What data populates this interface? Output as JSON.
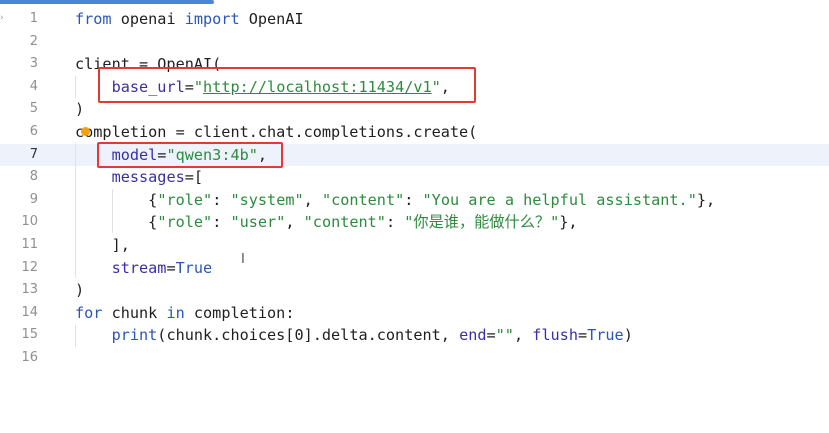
{
  "editor": {
    "accent_color": "#4a86d6",
    "highlight_color": "#e53935",
    "current_line": 7,
    "fold_icon": "fold-arrow-icon",
    "line_numbers": [
      "1",
      "2",
      "3",
      "4",
      "5",
      "6",
      "7",
      "8",
      "9",
      "10",
      "11",
      "12",
      "13",
      "14",
      "15",
      "16"
    ],
    "code": {
      "l1": {
        "kw1": "from",
        "mod": " openai ",
        "kw2": "import",
        "cls": " OpenAI"
      },
      "l3": {
        "text": "client = OpenAI("
      },
      "l4": {
        "param": "base_url",
        "eq": "=",
        "q1": "\"",
        "url": "http://localhost:11434/v1",
        "q2": "\"",
        "comma": ","
      },
      "l5": {
        "text": ")"
      },
      "l6": {
        "text": "completion = client.chat.completions.create("
      },
      "l7": {
        "param": "model",
        "eq": "=",
        "str": "\"qwen3:4b\"",
        "comma": ","
      },
      "l8": {
        "param": "messages",
        "eq": "=",
        "bracket": "["
      },
      "l9": {
        "open": "{",
        "k1": "\"role\"",
        "c1": ": ",
        "v1": "\"system\"",
        "sep": ", ",
        "k2": "\"content\"",
        "c2": ": ",
        "v2": "\"You are a helpful assistant.\"",
        "close": "},"
      },
      "l10": {
        "open": "{",
        "k1": "\"role\"",
        "c1": ": ",
        "v1": "\"user\"",
        "sep": ", ",
        "k2": "\"content\"",
        "c2": ": ",
        "v2_q1": "\"",
        "v2": "你是谁，能做什么？",
        "v2_q2": "\"",
        "close": "},"
      },
      "l11": {
        "text": "],"
      },
      "l12": {
        "param": "stream",
        "eq": "=",
        "val": "True"
      },
      "l13": {
        "text": ")"
      },
      "l14": {
        "kw1": "for",
        "mid": " chunk ",
        "kw2": "in",
        "rest": " completion:"
      },
      "l15": {
        "fn": "print",
        "a": "(chunk.choices[",
        "idx": "0",
        "b": "].delta.content, ",
        "p1": "end",
        "eq1": "=",
        "s1": "\"\"",
        "c": ", ",
        "p2": "flush",
        "eq2": "=",
        "v2": "True",
        "close": ")"
      }
    }
  }
}
